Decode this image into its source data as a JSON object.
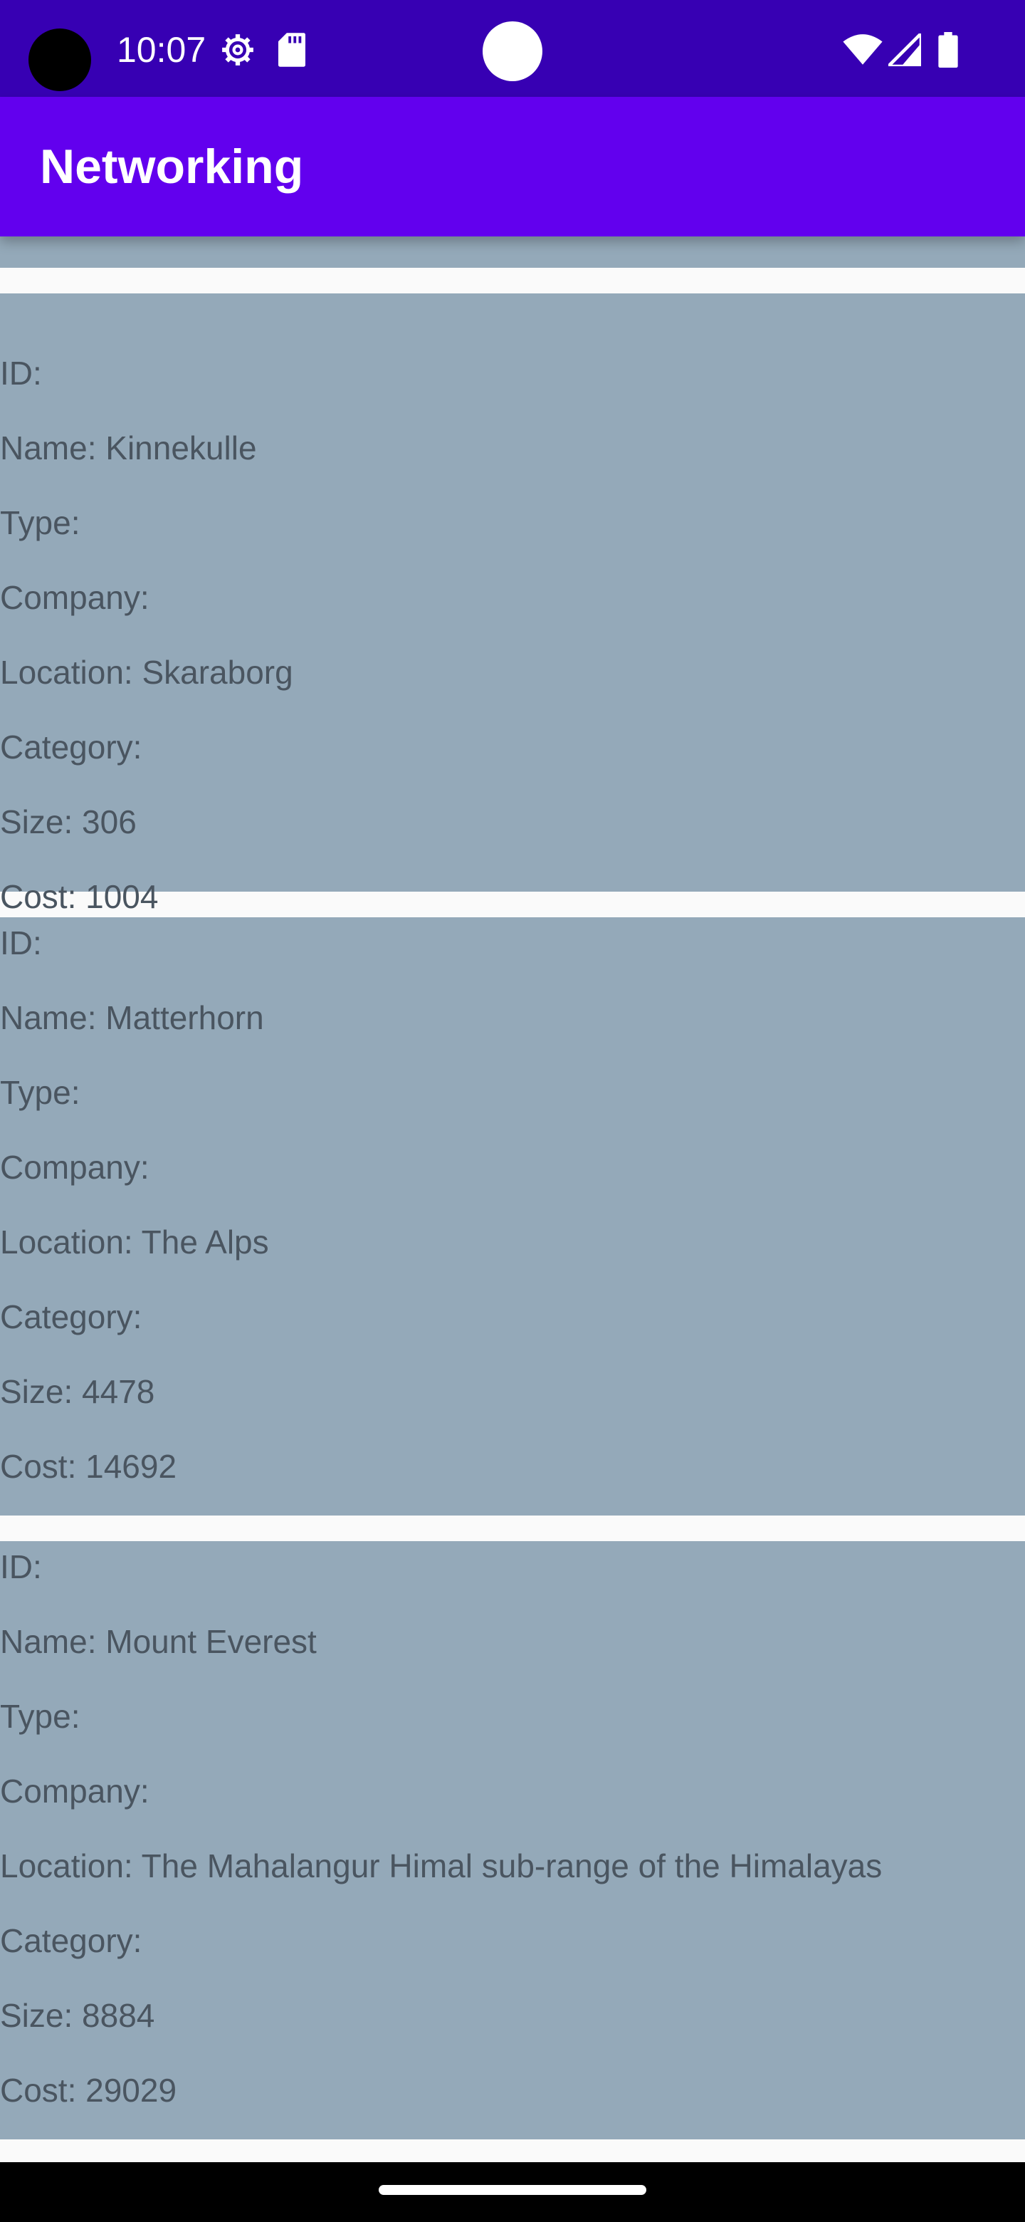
{
  "status_bar": {
    "time": "10:07",
    "icons": [
      "settings-gear-icon",
      "sd-card-icon",
      "wifi-icon",
      "cell-signal-icon",
      "battery-icon"
    ],
    "background": "#3700B3"
  },
  "app_bar": {
    "title": "Networking",
    "background": "#6200EE"
  },
  "list": {
    "item_background": "#94A9B9",
    "items": [
      {
        "id": "ID:",
        "name": "Name: Kinnekulle",
        "type": "Type:",
        "company": "Company:",
        "location": "Location: Skaraborg",
        "category": "Category:",
        "size": "Size: 306",
        "cost": "Cost: 1004"
      },
      {
        "id": "ID:",
        "name": "Name: Matterhorn",
        "type": "Type:",
        "company": "Company:",
        "location": "Location: The Alps",
        "category": "Category:",
        "size": "Size: 4478",
        "cost": "Cost: 14692"
      },
      {
        "id": "ID:",
        "name": "Name: Mount Everest",
        "type": "Type:",
        "company": "Company:",
        "location": "Location: The Mahalangur Himal sub-range of the Himalayas",
        "category": "Category:",
        "size": "Size: 8884",
        "cost": "Cost: 29029"
      }
    ]
  }
}
